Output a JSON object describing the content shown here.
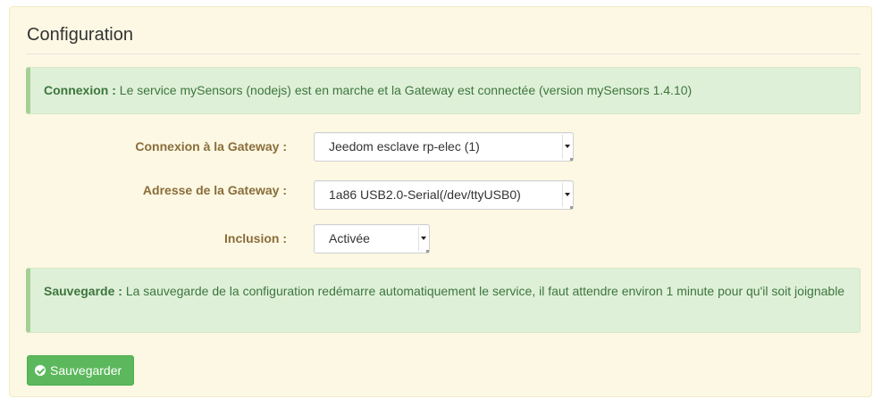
{
  "panel": {
    "legend": "Configuration"
  },
  "status_alert": {
    "label": "Connexion :",
    "message": "Le service mySensors (nodejs) est en marche et la Gateway est connectée (version mySensors 1.4.10)"
  },
  "form": {
    "gateway_connection": {
      "label": "Connexion à la Gateway :",
      "selected": "Jeedom esclave rp-elec (1)"
    },
    "gateway_address": {
      "label": "Adresse de la Gateway :",
      "selected": "1a86 USB2.0-Serial(/dev/ttyUSB0)"
    },
    "inclusion": {
      "label": "Inclusion :",
      "selected": "Activée"
    }
  },
  "save_alert": {
    "label": "Sauvegarde :",
    "message": "La sauvegarde de la configuration redémarre automatiquement le service, il faut attendre environ 1 minute pour qu'il soit joignable"
  },
  "save_button": {
    "label": "Sauvegarder",
    "icon": "check-circle-icon",
    "color": "#5cb85c"
  },
  "colors": {
    "panel_bg": "#fcf8e3",
    "alert_bg": "#dff0d8",
    "alert_text": "#3c763d",
    "label_text": "#8a6d3b"
  }
}
